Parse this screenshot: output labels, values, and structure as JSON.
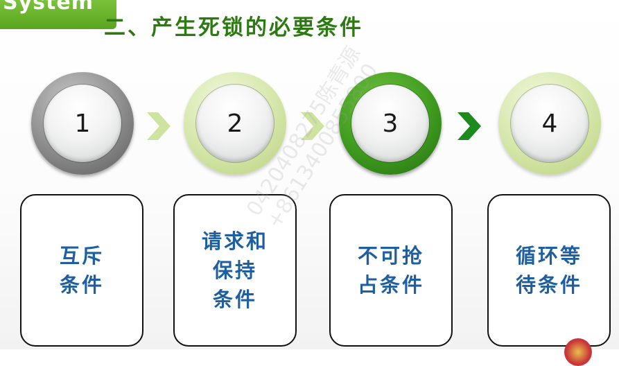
{
  "header": {
    "tab_text": "System",
    "title": "二、产生死锁的必要条件"
  },
  "steps": [
    {
      "number": "1",
      "label_lines": [
        "互斥",
        "条件"
      ]
    },
    {
      "number": "2",
      "label_lines": [
        "请求和",
        "保持",
        "条件"
      ]
    },
    {
      "number": "3",
      "label_lines": [
        "不可抢",
        "占条件"
      ]
    },
    {
      "number": "4",
      "label_lines": [
        "循环等",
        "待条件"
      ]
    }
  ],
  "watermark": {
    "line1": "0420408275陈青源",
    "line2": "+8613400855800"
  },
  "colors": {
    "title_green": "#2d7a12",
    "card_text_blue": "#1f5fa0",
    "tab_green": "#6cb52c",
    "chevron_light": "#cfe3a0",
    "chevron_dark": "#1d8a20"
  }
}
